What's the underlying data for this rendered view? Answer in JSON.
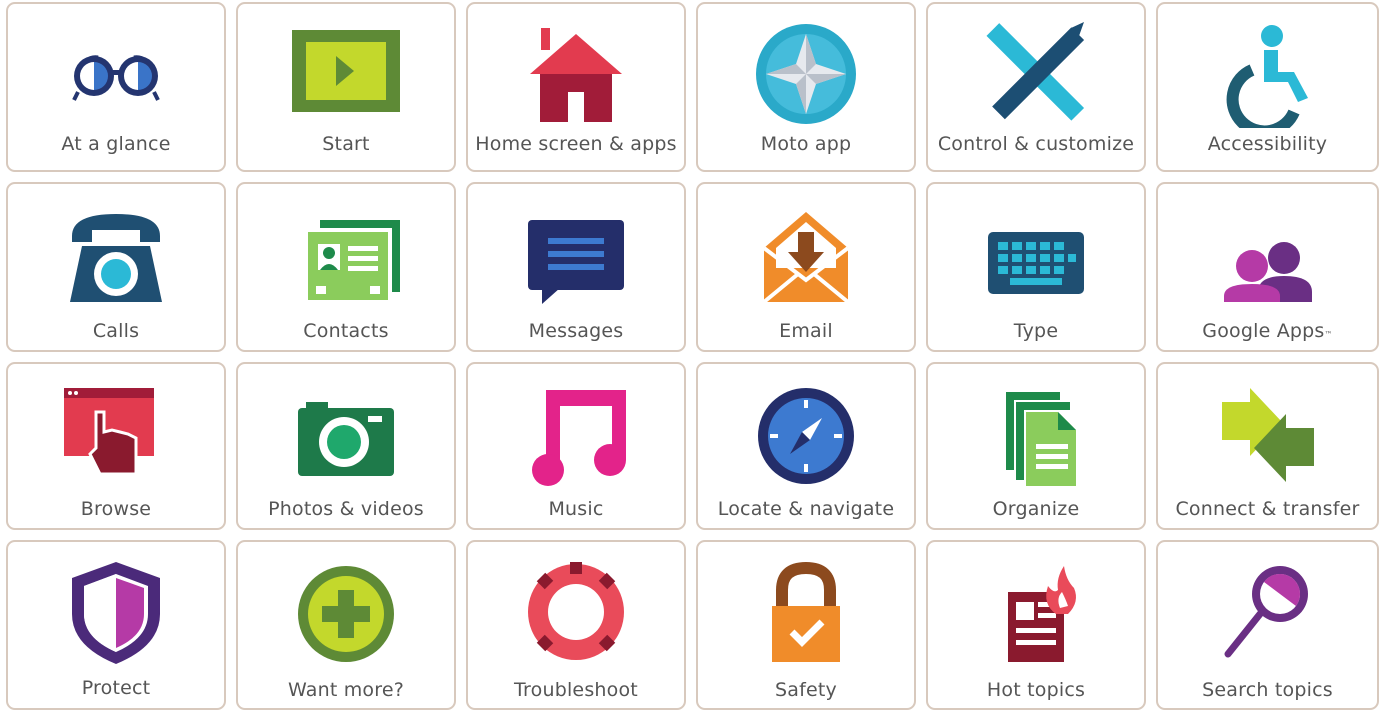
{
  "tiles": [
    {
      "label": "At a glance",
      "icon": "glasses-icon"
    },
    {
      "label": "Start",
      "icon": "play-screen-icon"
    },
    {
      "label": "Home screen & apps",
      "icon": "house-icon"
    },
    {
      "label": "Moto app",
      "icon": "moto-star-icon"
    },
    {
      "label": "Control & customize",
      "icon": "ruler-pencil-icon"
    },
    {
      "label": "Accessibility",
      "icon": "wheelchair-icon"
    },
    {
      "label": "Calls",
      "icon": "phone-icon"
    },
    {
      "label": "Contacts",
      "icon": "contact-card-icon"
    },
    {
      "label": "Messages",
      "icon": "message-bubble-icon"
    },
    {
      "label": "Email",
      "icon": "envelope-icon"
    },
    {
      "label": "Type",
      "icon": "keyboard-icon"
    },
    {
      "label": "Google Apps",
      "icon": "people-icon",
      "suffix": "™"
    },
    {
      "label": "Browse",
      "icon": "browser-hand-icon"
    },
    {
      "label": "Photos & videos",
      "icon": "camera-icon"
    },
    {
      "label": "Music",
      "icon": "music-note-icon"
    },
    {
      "label": "Locate & navigate",
      "icon": "compass-icon"
    },
    {
      "label": "Organize",
      "icon": "documents-icon"
    },
    {
      "label": "Connect & transfer",
      "icon": "transfer-arrows-icon"
    },
    {
      "label": "Protect",
      "icon": "shield-icon"
    },
    {
      "label": "Want more?",
      "icon": "plus-circle-icon"
    },
    {
      "label": "Troubleshoot",
      "icon": "lifebuoy-icon"
    },
    {
      "label": "Safety",
      "icon": "padlock-icon"
    },
    {
      "label": "Hot topics",
      "icon": "hot-news-icon"
    },
    {
      "label": "Search topics",
      "icon": "magnifier-icon"
    }
  ]
}
